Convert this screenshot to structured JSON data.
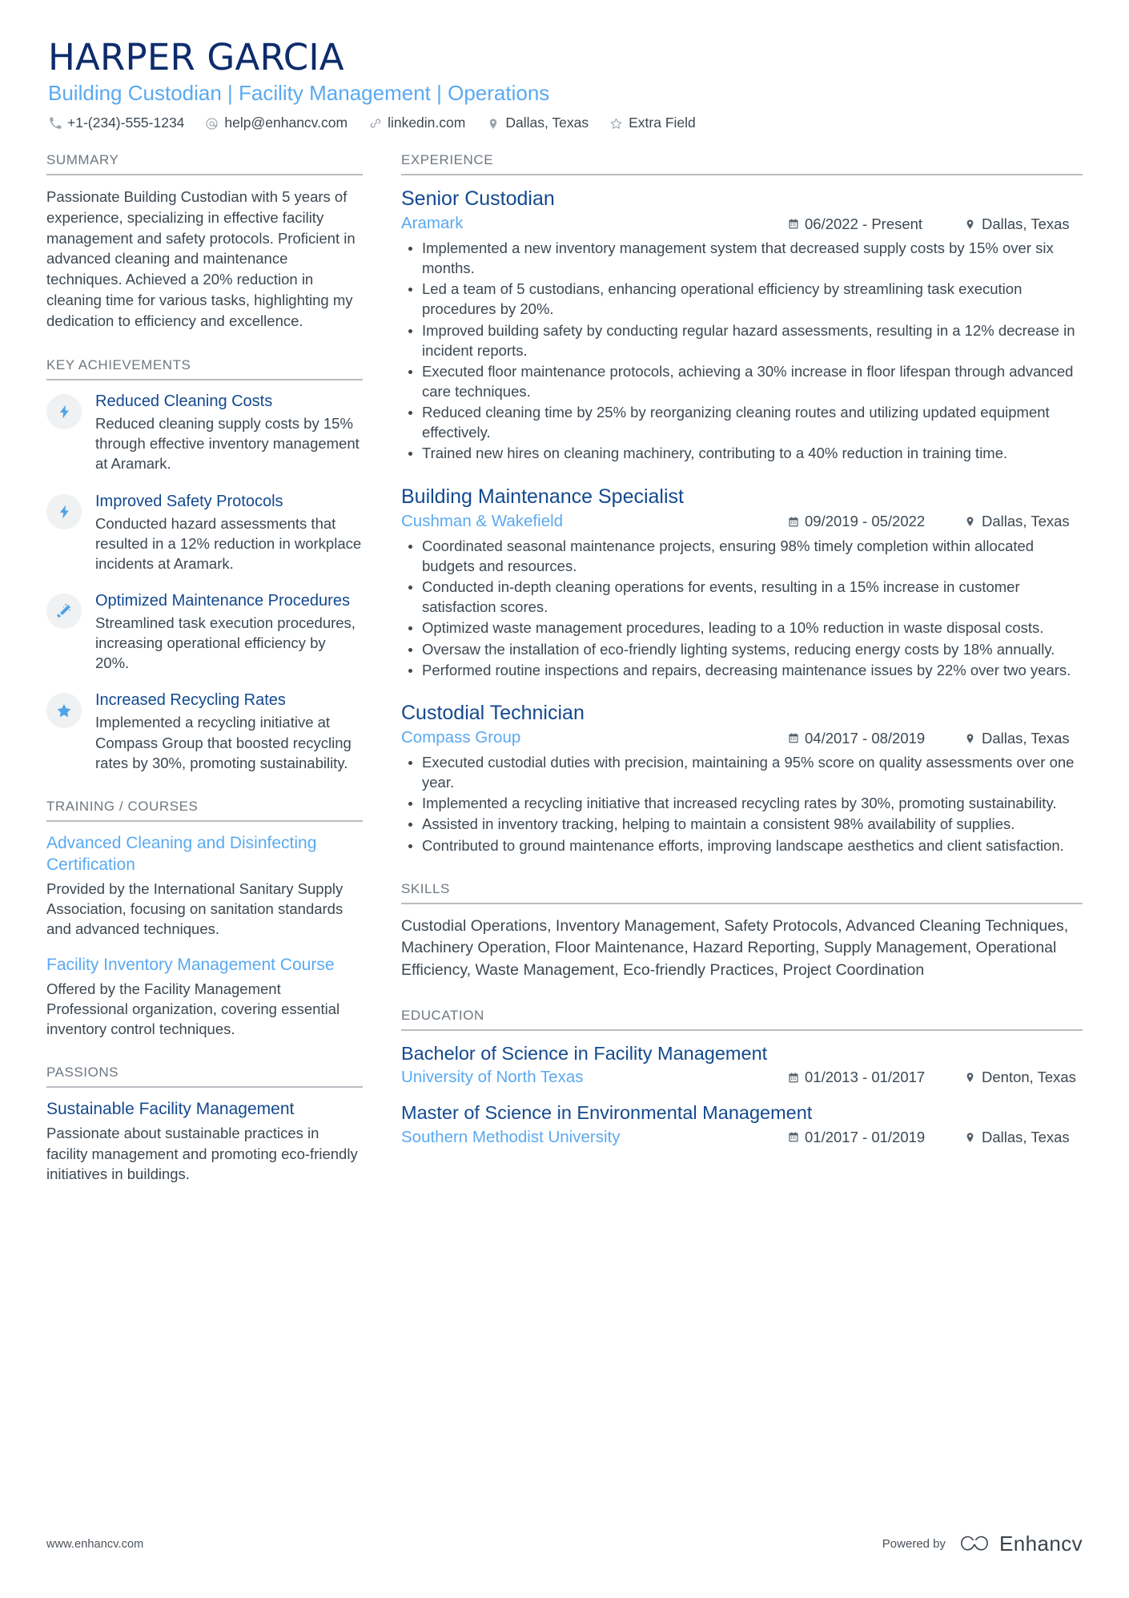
{
  "header": {
    "name": "HARPER GARCIA",
    "role": "Building Custodian | Facility Management | Operations",
    "contacts": [
      {
        "icon": "phone-icon",
        "text": "+1-(234)-555-1234"
      },
      {
        "icon": "email-icon",
        "text": "help@enhancv.com"
      },
      {
        "icon": "link-icon",
        "text": "linkedin.com"
      },
      {
        "icon": "location-pin-icon",
        "text": "Dallas, Texas"
      },
      {
        "icon": "star-outline-icon",
        "text": "Extra Field"
      }
    ]
  },
  "left": {
    "summary": {
      "title": "SUMMARY",
      "text": "Passionate Building Custodian with 5 years of experience, specializing in effective facility management and safety protocols. Proficient in advanced cleaning and maintenance techniques. Achieved a 20% reduction in cleaning time for various tasks, highlighting my dedication to efficiency and excellence."
    },
    "achievements": {
      "title": "KEY ACHIEVEMENTS",
      "items": [
        {
          "icon": "lightning-bolt-icon",
          "title": "Reduced Cleaning Costs",
          "desc": "Reduced cleaning supply costs by 15% through effective inventory management at Aramark."
        },
        {
          "icon": "lightning-bolt-icon",
          "title": "Improved Safety Protocols",
          "desc": "Conducted hazard assessments that resulted in a 12% reduction in workplace incidents at Aramark."
        },
        {
          "icon": "magic-wand-icon",
          "title": "Optimized Maintenance Procedures",
          "desc": "Streamlined task execution procedures, increasing operational efficiency by 20%."
        },
        {
          "icon": "star-filled-icon",
          "title": "Increased Recycling Rates",
          "desc": "Implemented a recycling initiative at Compass Group that boosted recycling rates by 30%, promoting sustainability."
        }
      ]
    },
    "training": {
      "title": "TRAINING / COURSES",
      "items": [
        {
          "title": "Advanced Cleaning and Disinfecting Certification",
          "desc": "Provided by the International Sanitary Supply Association, focusing on sanitation standards and advanced techniques."
        },
        {
          "title": "Facility Inventory Management Course",
          "desc": "Offered by the Facility Management Professional organization, covering essential inventory control techniques."
        }
      ]
    },
    "passions": {
      "title": "PASSIONS",
      "items": [
        {
          "title": "Sustainable Facility Management",
          "desc": "Passionate about sustainable practices in facility management and promoting eco-friendly initiatives in buildings."
        }
      ]
    }
  },
  "right": {
    "experience": {
      "title": "EXPERIENCE",
      "jobs": [
        {
          "role": "Senior Custodian",
          "company": "Aramark",
          "dates": "06/2022 - Present",
          "location": "Dallas, Texas",
          "bullets": [
            "Implemented a new inventory management system that decreased supply costs by 15% over six months.",
            "Led a team of 5 custodians, enhancing operational efficiency by streamlining task execution procedures by 20%.",
            "Improved building safety by conducting regular hazard assessments, resulting in a 12% decrease in incident reports.",
            "Executed floor maintenance protocols, achieving a 30% increase in floor lifespan through advanced care techniques.",
            "Reduced cleaning time by 25% by reorganizing cleaning routes and utilizing updated equipment effectively.",
            "Trained new hires on cleaning machinery, contributing to a 40% reduction in training time."
          ]
        },
        {
          "role": "Building Maintenance Specialist",
          "company": "Cushman & Wakefield",
          "dates": "09/2019 - 05/2022",
          "location": "Dallas, Texas",
          "bullets": [
            "Coordinated seasonal maintenance projects, ensuring 98% timely completion within allocated budgets and resources.",
            "Conducted in-depth cleaning operations for events, resulting in a 15% increase in customer satisfaction scores.",
            "Optimized waste management procedures, leading to a 10% reduction in waste disposal costs.",
            "Oversaw the installation of eco-friendly lighting systems, reducing energy costs by 18% annually.",
            "Performed routine inspections and repairs, decreasing maintenance issues by 22% over two years."
          ]
        },
        {
          "role": "Custodial Technician",
          "company": "Compass Group",
          "dates": "04/2017 - 08/2019",
          "location": "Dallas, Texas",
          "bullets": [
            "Executed custodial duties with precision, maintaining a 95% score on quality assessments over one year.",
            "Implemented a recycling initiative that increased recycling rates by 30%, promoting sustainability.",
            "Assisted in inventory tracking, helping to maintain a consistent 98% availability of supplies.",
            "Contributed to ground maintenance efforts, improving landscape aesthetics and client satisfaction."
          ]
        }
      ]
    },
    "skills": {
      "title": "SKILLS",
      "text": "Custodial Operations, Inventory Management, Safety Protocols, Advanced Cleaning Techniques, Machinery Operation, Floor Maintenance, Hazard Reporting, Supply Management, Operational Efficiency, Waste Management, Eco-friendly Practices, Project Coordination"
    },
    "education": {
      "title": "EDUCATION",
      "items": [
        {
          "degree": "Bachelor of Science in Facility Management",
          "school": "University of North Texas",
          "dates": "01/2013 - 01/2017",
          "location": "Denton, Texas"
        },
        {
          "degree": "Master of Science in Environmental Management",
          "school": "Southern Methodist University",
          "dates": "01/2017 - 01/2019",
          "location": "Dallas, Texas"
        }
      ]
    }
  },
  "footer": {
    "url": "www.enhancv.com",
    "powered_by": "Powered by",
    "brand": "Enhancv"
  },
  "colors": {
    "name_navy": "#0d2c6c",
    "heading_navy": "#13498f",
    "accent_blue": "#5aa9f0",
    "body_gray": "#3d4852",
    "rule_gray": "#b9bdc2",
    "badge_bg": "#f0f1f2"
  }
}
